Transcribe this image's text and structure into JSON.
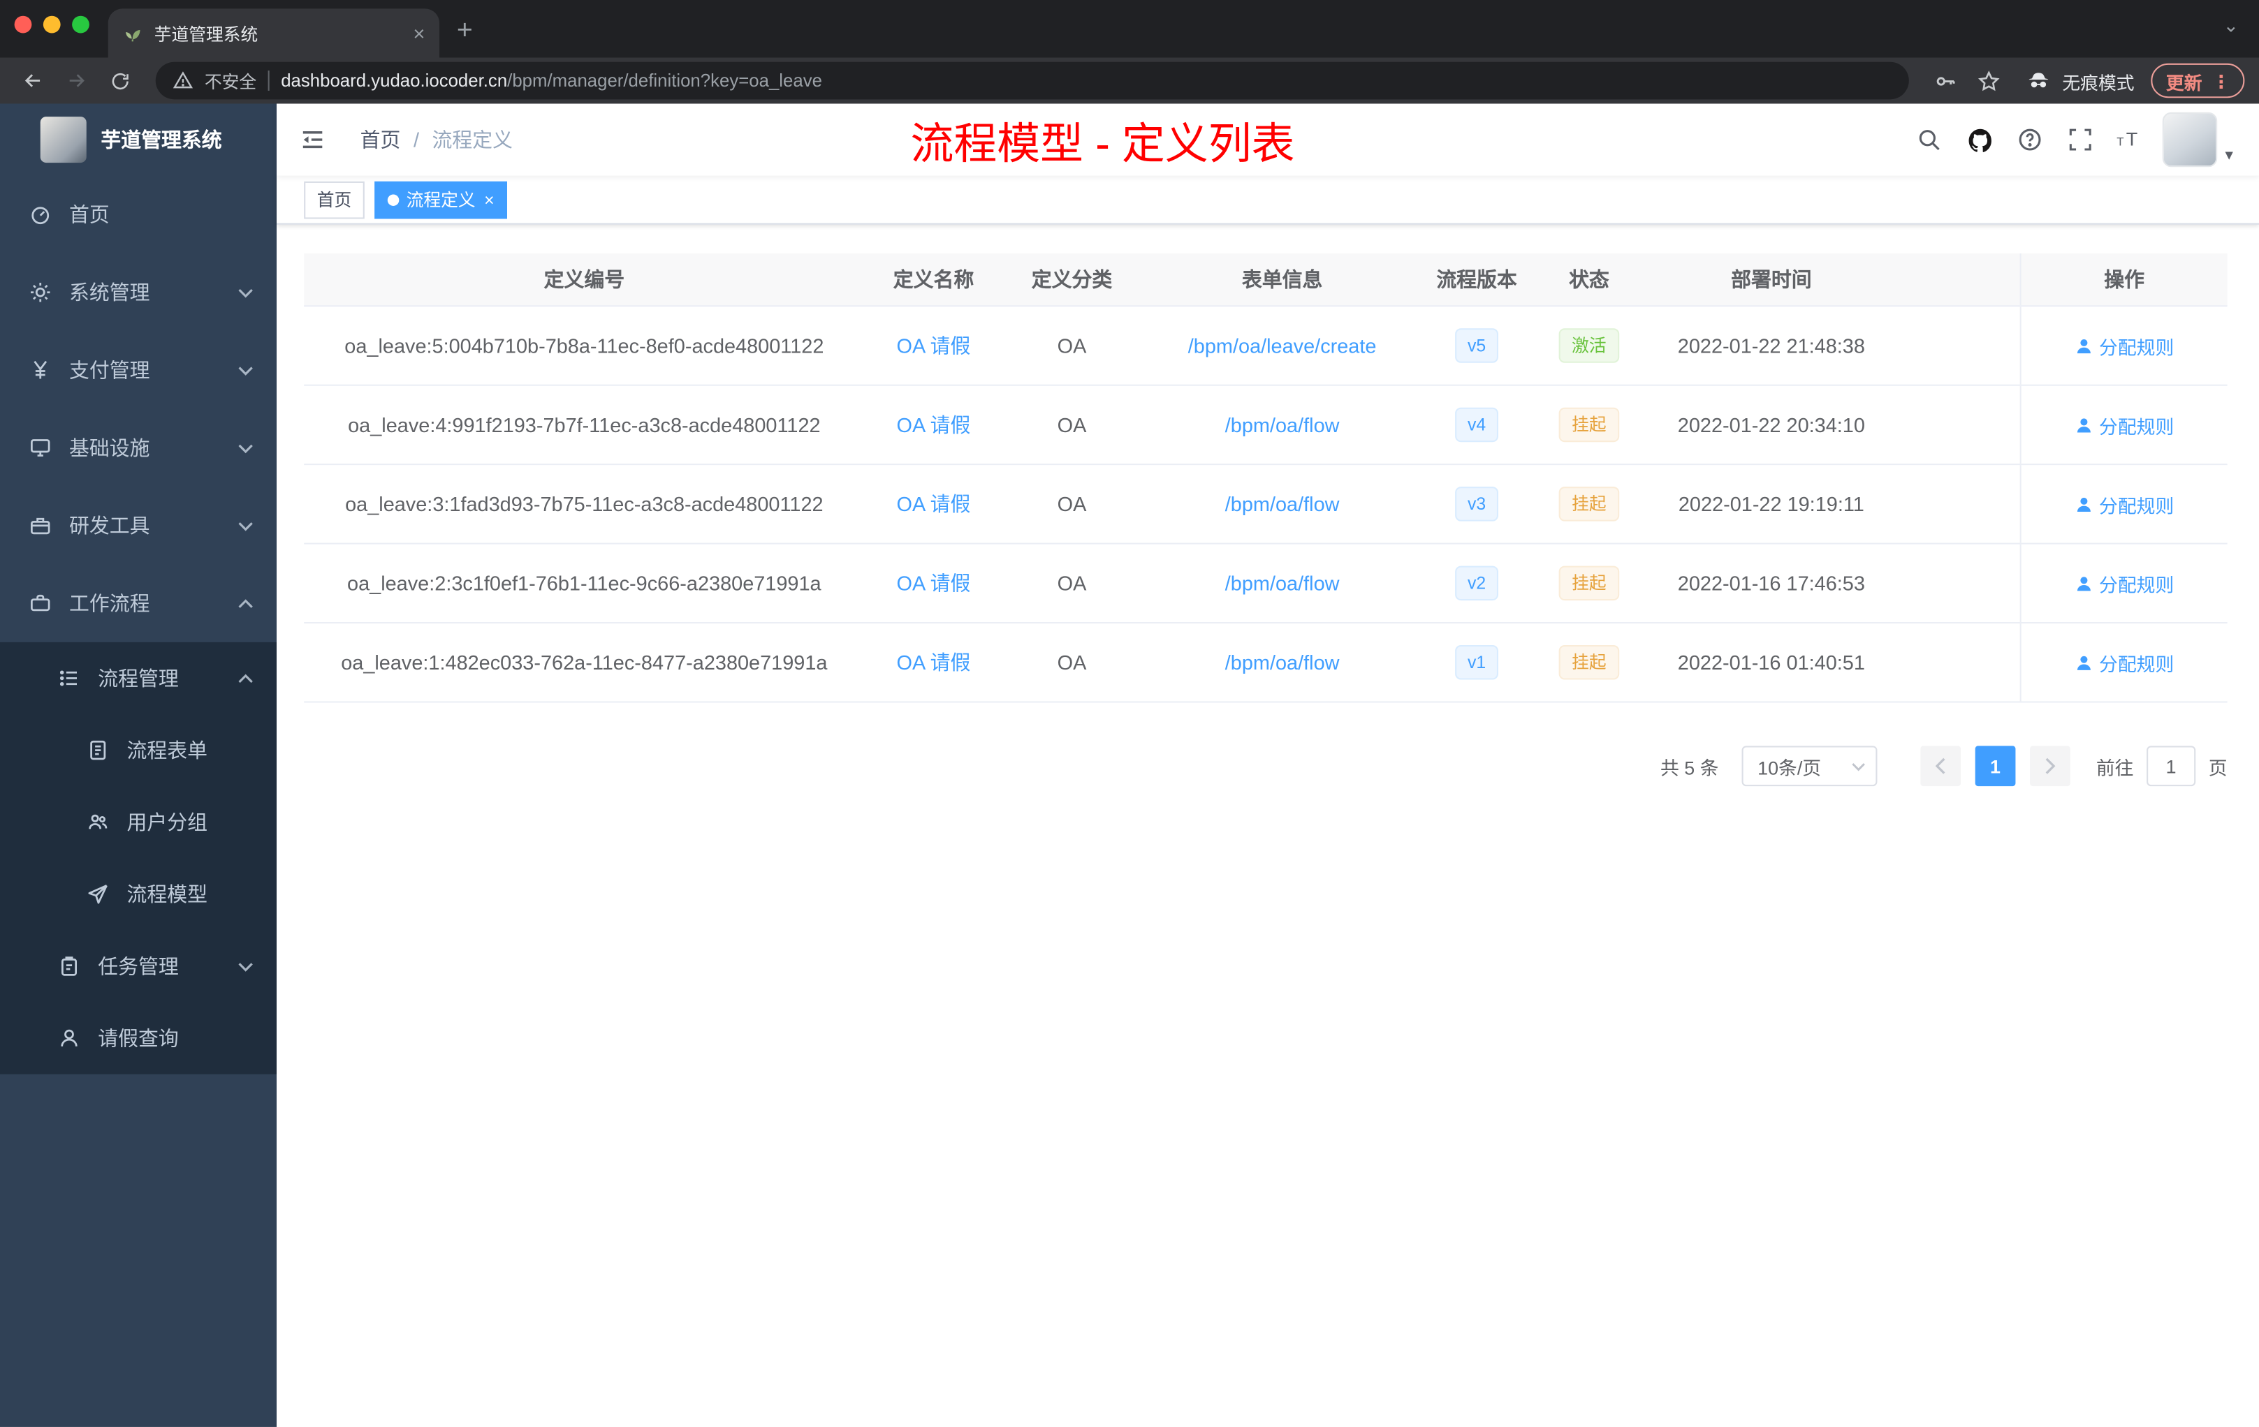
{
  "icons": {
    "close": "×",
    "new_tab": "+",
    "tab_search_caret": "⌄",
    "caret_down": "▾",
    "kebab": "⋮",
    "breadcrumb_separator": "/"
  },
  "browser": {
    "tab_title": "芋道管理系统",
    "security_label": "不安全",
    "url_domain": "dashboard.yudao.iocoder.cn",
    "url_path": "/bpm/manager/definition?key=oa_leave",
    "incognito_label": "无痕模式",
    "update_label": "更新"
  },
  "sidebar": {
    "logo_title": "芋道管理系统",
    "menu": [
      {
        "label": "首页"
      },
      {
        "label": "系统管理"
      },
      {
        "label": "支付管理"
      },
      {
        "label": "基础设施"
      },
      {
        "label": "研发工具"
      },
      {
        "label": "工作流程"
      }
    ],
    "submenu": {
      "process_mgmt": "流程管理",
      "process_form": "流程表单",
      "user_group": "用户分组",
      "process_model": "流程模型",
      "task_mgmt": "任务管理",
      "leave_query": "请假查询"
    }
  },
  "header": {
    "breadcrumb": [
      "首页",
      "流程定义"
    ],
    "annotation": "流程模型 - 定义列表"
  },
  "tags": [
    {
      "label": "首页"
    },
    {
      "label": "流程定义"
    }
  ],
  "table": {
    "columns": [
      "定义编号",
      "定义名称",
      "定义分类",
      "表单信息",
      "流程版本",
      "状态",
      "部署时间",
      "操作"
    ],
    "action_label": "分配规则",
    "rows": [
      {
        "id": "oa_leave:5:004b710b-7b8a-11ec-8ef0-acde48001122",
        "name": "OA 请假",
        "category": "OA",
        "form": "/bpm/oa/leave/create",
        "version": "v5",
        "status": "激活",
        "time": "2022-01-22 21:48:38"
      },
      {
        "id": "oa_leave:4:991f2193-7b7f-11ec-a3c8-acde48001122",
        "name": "OA 请假",
        "category": "OA",
        "form": "/bpm/oa/flow",
        "version": "v4",
        "status": "挂起",
        "time": "2022-01-22 20:34:10"
      },
      {
        "id": "oa_leave:3:1fad3d93-7b75-11ec-a3c8-acde48001122",
        "name": "OA 请假",
        "category": "OA",
        "form": "/bpm/oa/flow",
        "version": "v3",
        "status": "挂起",
        "time": "2022-01-22 19:19:11"
      },
      {
        "id": "oa_leave:2:3c1f0ef1-76b1-11ec-9c66-a2380e71991a",
        "name": "OA 请假",
        "category": "OA",
        "form": "/bpm/oa/flow",
        "version": "v2",
        "status": "挂起",
        "time": "2022-01-16 17:46:53"
      },
      {
        "id": "oa_leave:1:482ec033-762a-11ec-8477-a2380e71991a",
        "name": "OA 请假",
        "category": "OA",
        "form": "/bpm/oa/flow",
        "version": "v1",
        "status": "挂起",
        "time": "2022-01-16 01:40:51"
      }
    ]
  },
  "pagination": {
    "total": "共 5 条",
    "page_size": "10条/页",
    "current_page": "1",
    "goto_label": "前往",
    "goto_value": "1",
    "goto_suffix": "页"
  },
  "colors": {
    "primary": "#409eff",
    "success": "#67c23a",
    "warning": "#e6a23c",
    "annotation_red": "#ff0000",
    "sidebar_bg": "#304156",
    "submenu_bg": "#1f2d3d"
  }
}
